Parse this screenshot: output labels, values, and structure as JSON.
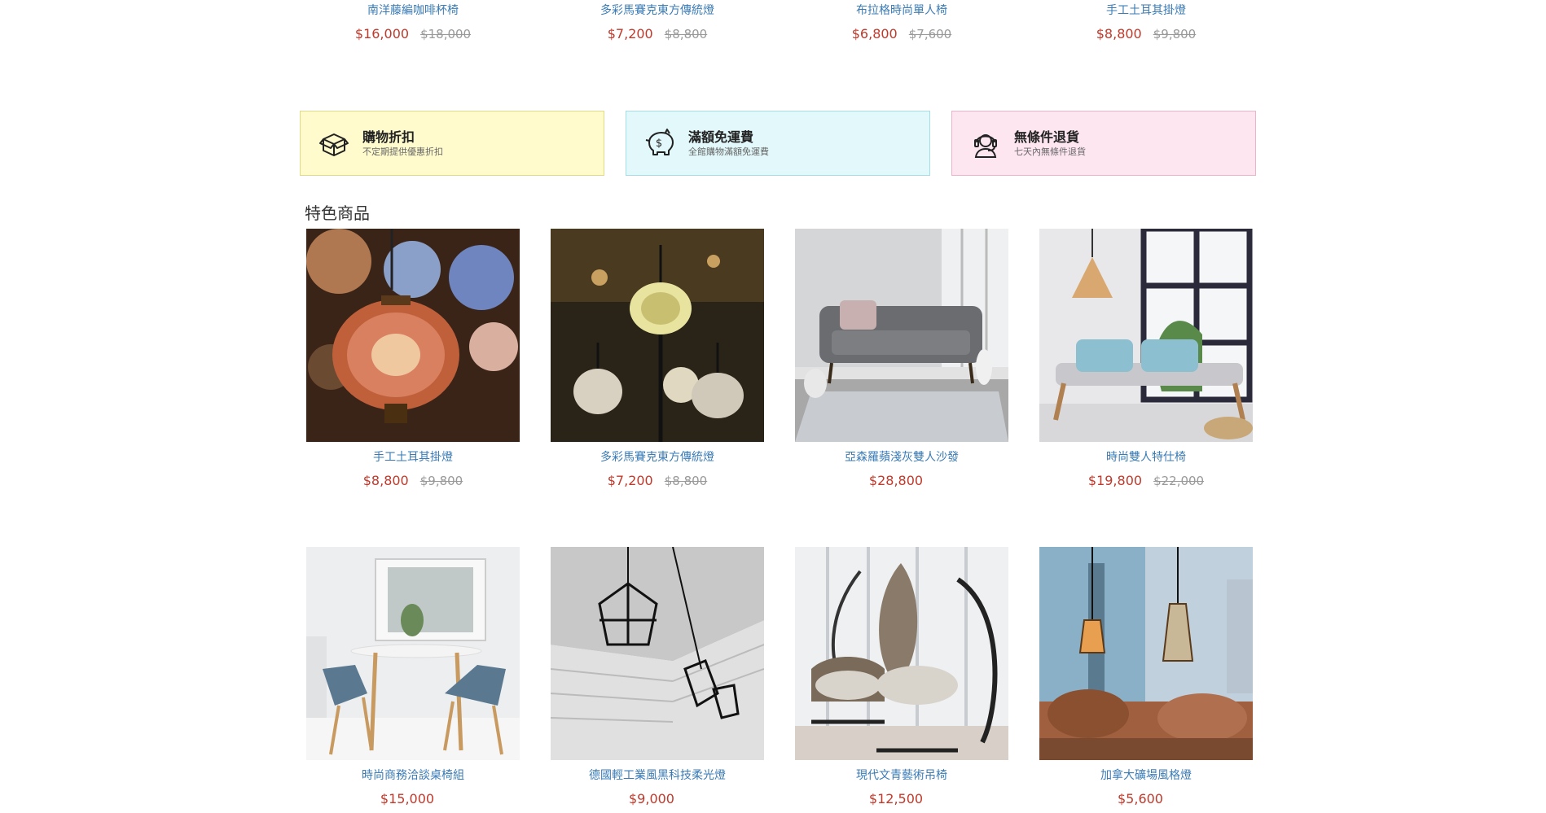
{
  "top_row": [
    {
      "name": "南洋藤編咖啡杯椅",
      "price": "$16,000",
      "original": "$18,000"
    },
    {
      "name": "多彩馬賽克東方傳統燈",
      "price": "$7,200",
      "original": "$8,800"
    },
    {
      "name": "布拉格時尚單人椅",
      "price": "$6,800",
      "original": "$7,600"
    },
    {
      "name": "手工土耳其掛燈",
      "price": "$8,800",
      "original": "$9,800"
    }
  ],
  "features": [
    {
      "title": "購物折扣",
      "subtitle": "不定期提供優惠折扣",
      "icon": "box-icon",
      "bg": "#fffbcc",
      "border": "#e3d98a"
    },
    {
      "title": "滿額免運費",
      "subtitle": "全館購物滿額免運費",
      "icon": "piggy-bank-icon",
      "bg": "#e2f8fb",
      "border": "#a6dde6"
    },
    {
      "title": "無條件退貨",
      "subtitle": "七天內無條件退貨",
      "icon": "headset-support-icon",
      "bg": "#fde6f0",
      "border": "#e9b5c8"
    }
  ],
  "section": {
    "title": "特色商品"
  },
  "products": [
    {
      "name": "手工土耳其掛燈",
      "price": "$8,800",
      "original": "$9,800"
    },
    {
      "name": "多彩馬賽克東方傳統燈",
      "price": "$7,200",
      "original": "$8,800"
    },
    {
      "name": "亞森羅蘋淺灰雙人沙發",
      "price": "$28,800",
      "original": ""
    },
    {
      "name": "時尚雙人特仕椅",
      "price": "$19,800",
      "original": "$22,000"
    },
    {
      "name": "時尚商務洽談桌椅組",
      "price": "$15,000",
      "original": ""
    },
    {
      "name": "德國輕工業風黑科技柔光燈",
      "price": "$9,000",
      "original": ""
    },
    {
      "name": "現代文青藝術吊椅",
      "price": "$12,500",
      "original": ""
    },
    {
      "name": "加拿大礦場風格燈",
      "price": "$5,600",
      "original": ""
    }
  ]
}
